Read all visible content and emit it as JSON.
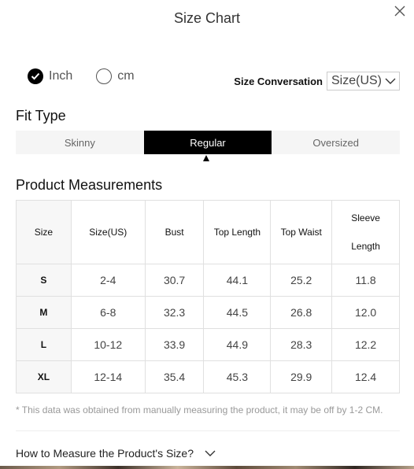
{
  "dialog": {
    "title": "Size Chart"
  },
  "units": {
    "inch": "Inch",
    "cm": "cm",
    "selected": "inch"
  },
  "conversation": {
    "label": "Size Conversation",
    "value": "Size(US)"
  },
  "fit_type": {
    "heading": "Fit Type",
    "tabs": [
      "Skinny",
      "Regular",
      "Oversized"
    ],
    "active": "Regular"
  },
  "measurements": {
    "heading": "Product Measurements",
    "headers": {
      "size": "Size",
      "size_us": "Size(US)",
      "bust": "Bust",
      "top_length": "Top Length",
      "top_waist": "Top Waist",
      "sleeve_1": "Sleeve",
      "sleeve_2": "Length"
    },
    "rows": [
      {
        "size": "S",
        "size_us": "2-4",
        "bust": "30.7",
        "top_length": "44.1",
        "top_waist": "25.2",
        "sleeve": "11.8"
      },
      {
        "size": "M",
        "size_us": "6-8",
        "bust": "32.3",
        "top_length": "44.5",
        "top_waist": "26.8",
        "sleeve": "12.0"
      },
      {
        "size": "L",
        "size_us": "10-12",
        "bust": "33.9",
        "top_length": "44.9",
        "top_waist": "28.3",
        "sleeve": "12.2"
      },
      {
        "size": "XL",
        "size_us": "12-14",
        "bust": "35.4",
        "top_length": "45.3",
        "top_waist": "29.9",
        "sleeve": "12.4"
      }
    ]
  },
  "note": "* This data was obtained from manually measuring the product, it may be off by 1-2 CM.",
  "how_to": {
    "label": "How to Measure the Product's Size?"
  },
  "colors": {
    "active_tab": "#000000",
    "tab_bg": "#f5f5f5",
    "border": "#e0e0e0"
  },
  "icons": {
    "close": "close-icon",
    "checked": "check-circle-icon",
    "dropdown": "chevron-down-icon"
  }
}
